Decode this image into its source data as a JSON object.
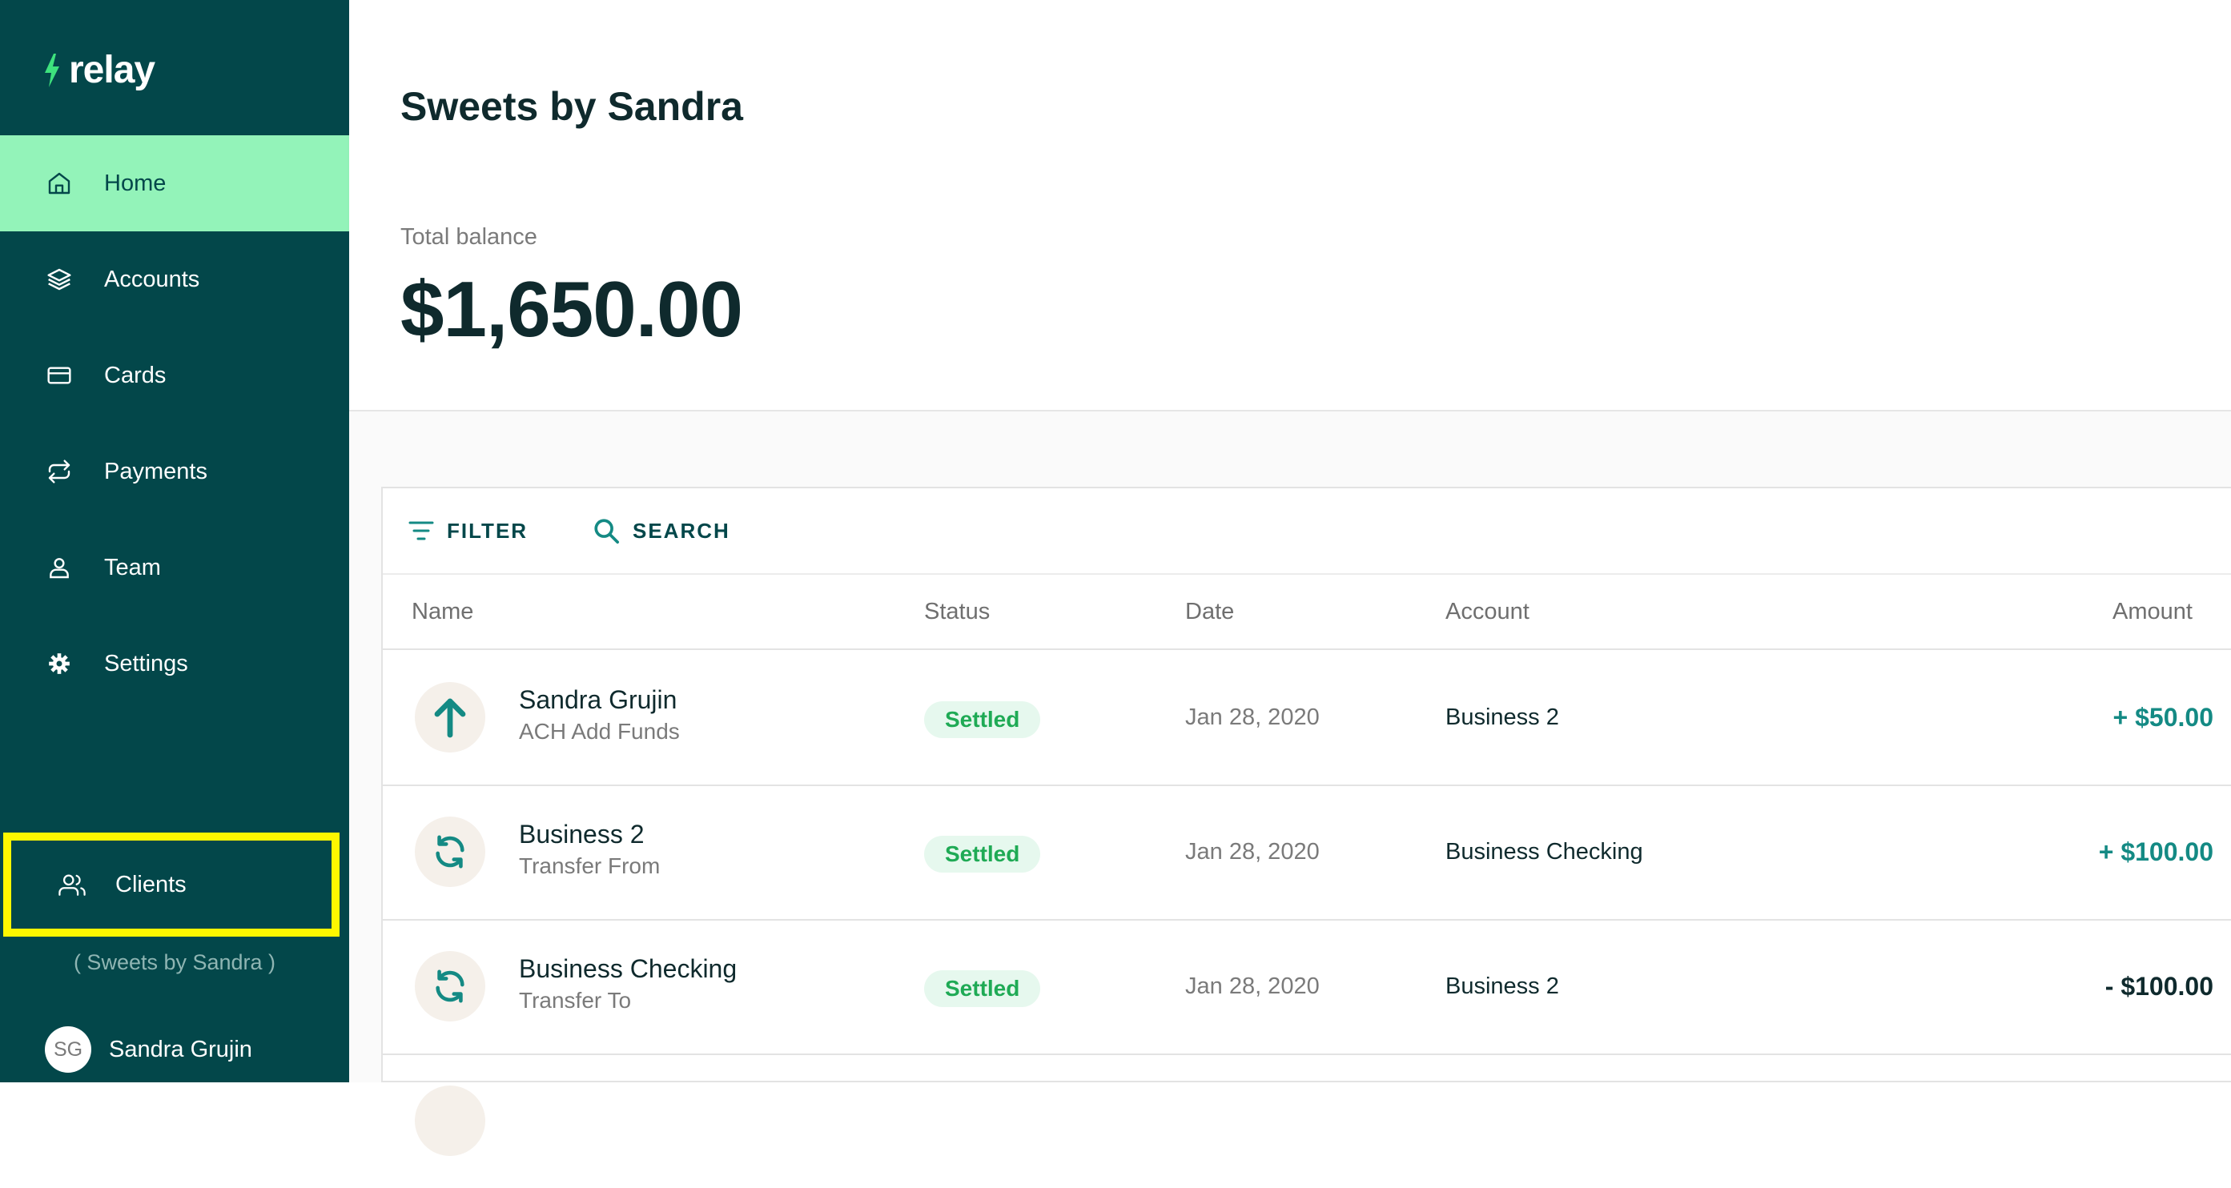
{
  "app": {
    "logo_text": "relay"
  },
  "sidebar": {
    "items": [
      {
        "label": "Home",
        "icon": "home-icon",
        "active": true
      },
      {
        "label": "Accounts",
        "icon": "layers-icon"
      },
      {
        "label": "Cards",
        "icon": "credit-card-icon"
      },
      {
        "label": "Payments",
        "icon": "repeat-icon"
      },
      {
        "label": "Team",
        "icon": "user-icon"
      },
      {
        "label": "Settings",
        "icon": "gear-icon"
      }
    ],
    "clients_label": "Clients",
    "business_name": "( Sweets by Sandra )",
    "user": {
      "initials": "SG",
      "name": "Sandra Grujin"
    }
  },
  "header": {
    "title": "Sweets by Sandra",
    "balance_label": "Total balance",
    "balance_value": "$1,650.00"
  },
  "toolbar": {
    "filter_label": "FILTER",
    "search_label": "SEARCH"
  },
  "table": {
    "columns": [
      "Name",
      "Status",
      "Date",
      "Account",
      "Amount"
    ],
    "rows": [
      {
        "icon": "arrow-up-icon",
        "name": "Sandra Grujin",
        "subtitle": "ACH Add Funds",
        "status": "Settled",
        "date": "Jan 28, 2020",
        "account": "Business 2",
        "amount": "+ $50.00"
      },
      {
        "icon": "refresh-icon",
        "name": "Business 2",
        "subtitle": "Transfer From",
        "status": "Settled",
        "date": "Jan 28, 2020",
        "account": "Business Checking",
        "amount": "+ $100.00"
      },
      {
        "icon": "refresh-icon",
        "name": "Business Checking",
        "subtitle": "Transfer To",
        "status": "Settled",
        "date": "Jan 28, 2020",
        "account": "Business 2",
        "amount": "- $100.00"
      }
    ]
  },
  "colors": {
    "sidebar_bg": "#03474a",
    "active_nav_bg": "#93f3b9",
    "highlight_border": "#fff700",
    "accent_teal": "#148a84",
    "status_green": "#1faa55"
  }
}
